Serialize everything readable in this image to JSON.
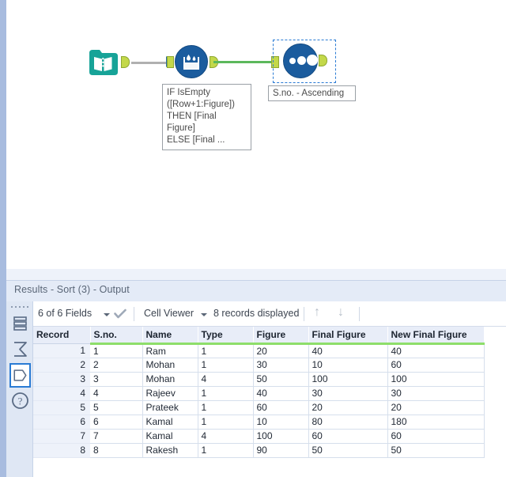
{
  "canvas": {
    "tools": [
      {
        "id": "input-data",
        "icon": "book-icon",
        "name": "Input Data",
        "annotation": ""
      },
      {
        "id": "multi-row-formula",
        "icon": "beaker-drop-icon",
        "name": "Multi-Row Formula",
        "annotation": "IF IsEmpty\n([Row+1:Figure])\nTHEN [Final\nFigure]\nELSE [Final ..."
      },
      {
        "id": "sort",
        "icon": "three-dots-icon",
        "name": "Sort",
        "annotation": "S.no. - Ascending"
      }
    ],
    "connections": [
      {
        "from": "input-data",
        "to": "multi-row-formula",
        "color": "#b0b0b0"
      },
      {
        "from": "multi-row-formula",
        "to": "sort",
        "color": "#5cb85c"
      }
    ]
  },
  "results": {
    "title": "Results - Sort (3) - Output",
    "rail": [
      {
        "name": "all-tools-icon",
        "label": "All Tools"
      },
      {
        "name": "sigma-icon",
        "label": "Messages"
      },
      {
        "name": "data-tag-icon",
        "label": "Data Output",
        "selected": true
      },
      {
        "name": "help-icon",
        "label": "Help"
      }
    ],
    "toolbar": {
      "fields_label": "6 of 6 Fields",
      "checkmark": "✔",
      "viewer_label": "Cell Viewer",
      "records_label": "8 records displayed",
      "up_arrow": "↑",
      "down_arrow": "↓"
    },
    "table": {
      "columns": [
        "Record",
        "S.no.",
        "Name",
        "Type",
        "Figure",
        "Final Figure",
        "New Final Figure"
      ],
      "rows": [
        [
          "1",
          "1",
          "Ram",
          "1",
          "20",
          "40",
          "40"
        ],
        [
          "2",
          "2",
          "Mohan",
          "1",
          "30",
          "10",
          "60"
        ],
        [
          "3",
          "3",
          "Mohan",
          "4",
          "50",
          "100",
          "100"
        ],
        [
          "4",
          "4",
          "Rajeev",
          "1",
          "40",
          "30",
          "30"
        ],
        [
          "5",
          "5",
          "Prateek",
          "1",
          "60",
          "20",
          "20"
        ],
        [
          "6",
          "6",
          "Kamal",
          "1",
          "10",
          "80",
          "180"
        ],
        [
          "7",
          "7",
          "Kamal",
          "4",
          "100",
          "60",
          "60"
        ],
        [
          "8",
          "8",
          "Rakesh",
          "1",
          "90",
          "50",
          "50"
        ]
      ]
    }
  },
  "colors": {
    "input_tool": "#17a398",
    "blue_tool": "#1b5c9e",
    "anchor": "#c3d84a",
    "green_connection": "#5cb85c",
    "gray_connection": "#b0b0b0",
    "selection_outline": "#2a7bd4",
    "header_underline": "#8ede6a",
    "panel_blue": "#a8bcdf"
  }
}
